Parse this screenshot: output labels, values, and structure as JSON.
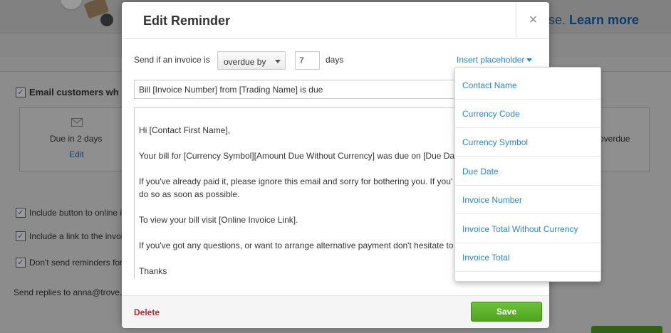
{
  "background": {
    "learn_more_prefix": "se. ",
    "learn_more": "Learn more",
    "email_customers": "Email customers wh",
    "card_left_label": "Due in 2 days",
    "card_left_link": "Edit",
    "card_right_label": "overdue",
    "option_1": "Include button to online i",
    "option_2": "Include a link to the invoi",
    "option_3": "Don't send reminders for",
    "send_replies": "Send replies to anna@trove."
  },
  "modal": {
    "title": "Edit Reminder",
    "close_glyph": "×",
    "send_label": "Send if an invoice is",
    "condition_select": "overdue by",
    "days_value": "7",
    "days_label": "days",
    "insert_placeholder": "Insert placeholder",
    "subject_value": "Bill [Invoice Number] from [Trading Name] is due",
    "body_lines": [
      "Hi [Contact First Name],",
      "Your bill for [Currency Symbol][Amount Due Without Currency]  was due on [Due Da",
      "If you've already paid it, please ignore this email and sorry for bothering you.  If you'",
      "do so as soon as possible.",
      "To view your bill visit [Online Invoice Link].",
      "If you've got any questions, or want to arrange alternative payment don't hesitate to",
      "Thanks"
    ],
    "delete_label": "Delete",
    "save_label": "Save"
  },
  "placeholder_menu": {
    "items": [
      "Contact Name",
      "Currency Code",
      "Currency Symbol",
      "Due Date",
      "Invoice Number",
      "Invoice Total Without Currency",
      "Invoice Total"
    ]
  },
  "colors": {
    "link_blue": "#2a86c8",
    "save_green": "#5cb22a",
    "delete_red": "#c0252b"
  }
}
